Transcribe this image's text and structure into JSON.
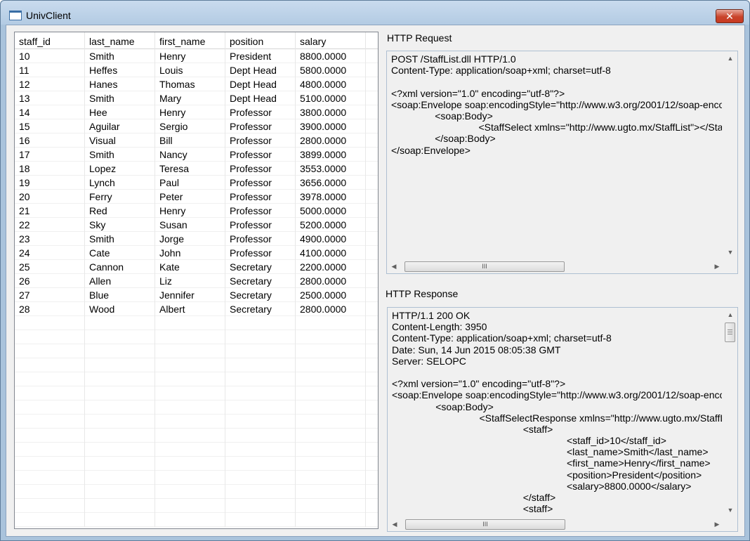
{
  "window": {
    "title": "UnivClient",
    "close_glyph": "✕"
  },
  "grid": {
    "columns": [
      "staff_id",
      "last_name",
      "first_name",
      "position",
      "salary"
    ],
    "rows": [
      [
        "10",
        "Smith",
        "Henry",
        "President",
        "8800.0000"
      ],
      [
        "11",
        "Heffes",
        "Louis",
        "Dept Head",
        "5800.0000"
      ],
      [
        "12",
        "Hanes",
        "Thomas",
        "Dept Head",
        "4800.0000"
      ],
      [
        "13",
        "Smith",
        "Mary",
        "Dept Head",
        "5100.0000"
      ],
      [
        "14",
        "Hee",
        "Henry",
        "Professor",
        "3800.0000"
      ],
      [
        "15",
        "Aguilar",
        "Sergio",
        "Professor",
        "3900.0000"
      ],
      [
        "16",
        "Visual",
        "Bill",
        "Professor",
        "2800.0000"
      ],
      [
        "17",
        "Smith",
        "Nancy",
        "Professor",
        "3899.0000"
      ],
      [
        "18",
        "Lopez",
        "Teresa",
        "Professor",
        "3553.0000"
      ],
      [
        "19",
        "Lynch",
        "Paul",
        "Professor",
        "3656.0000"
      ],
      [
        "20",
        "Ferry",
        "Peter",
        "Professor",
        "3978.0000"
      ],
      [
        "21",
        "Red",
        "Henry",
        "Professor",
        "5000.0000"
      ],
      [
        "22",
        "Sky",
        "Susan",
        "Professor",
        "5200.0000"
      ],
      [
        "23",
        "Smith",
        "Jorge",
        "Professor",
        "4900.0000"
      ],
      [
        "24",
        "Cate",
        "John",
        "Professor",
        "4100.0000"
      ],
      [
        "25",
        "Cannon",
        "Kate",
        "Secretary",
        "2200.0000"
      ],
      [
        "26",
        "Allen",
        "Liz",
        "Secretary",
        "2800.0000"
      ],
      [
        "27",
        "Blue",
        "Jennifer",
        "Secretary",
        "2500.0000"
      ],
      [
        "28",
        "Wood",
        "Albert",
        "Secretary",
        "2800.0000"
      ]
    ]
  },
  "request": {
    "label": "HTTP Request",
    "lines": [
      "POST /StaffList.dll HTTP/1.0",
      "Content-Type: application/soap+xml; charset=utf-8",
      "",
      "<?xml version=\"1.0\" encoding=\"utf-8\"?>",
      "<soap:Envelope soap:encodingStyle=\"http://www.w3.org/2001/12/soap-encoding\"",
      "                <soap:Body>",
      "                                <StaffSelect xmlns=\"http://www.ugto.mx/StaffList\"></StaffSelect>",
      "                </soap:Body>",
      "</soap:Envelope>"
    ]
  },
  "response": {
    "label": "HTTP Response",
    "lines": [
      "HTTP/1.1 200 OK",
      "Content-Length: 3950",
      "Content-Type: application/soap+xml; charset=utf-8",
      "Date: Sun, 14 Jun 2015 08:05:38 GMT",
      "Server: SELOPC",
      "",
      "<?xml version=\"1.0\" encoding=\"utf-8\"?>",
      "<soap:Envelope soap:encodingStyle=\"http://www.w3.org/2001/12/soap-encoding\"",
      "                <soap:Body>",
      "                                <StaffSelectResponse xmlns=\"http://www.ugto.mx/StaffList\">",
      "                                                <staff>",
      "                                                                <staff_id>10</staff_id>",
      "                                                                <last_name>Smith</last_name>",
      "                                                                <first_name>Henry</first_name>",
      "                                                                <position>President</position>",
      "                                                                <salary>8800.0000</salary>",
      "                                                </staff>",
      "                                                <staff>"
    ]
  },
  "scrollbar": {
    "up": "▲",
    "down": "▼",
    "left": "◀",
    "right": "▶",
    "grip": "III"
  }
}
